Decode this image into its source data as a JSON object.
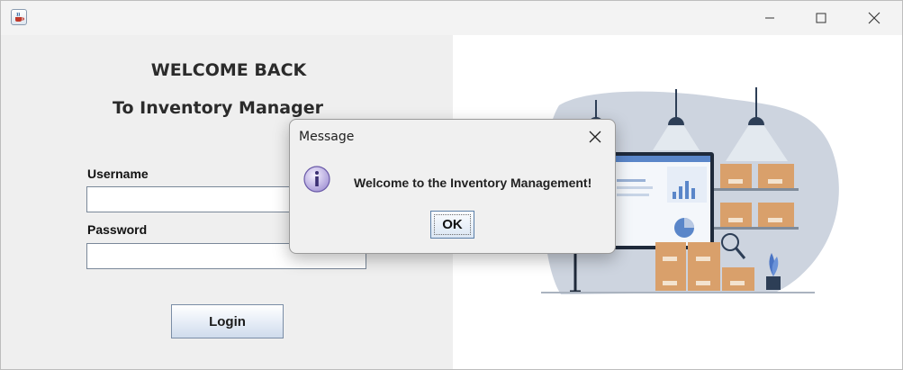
{
  "window": {
    "icon": "java-cup-icon",
    "controls": [
      "minimize-icon",
      "maximize-icon",
      "close-icon"
    ]
  },
  "login": {
    "welcome": "WELCOME BACK",
    "subtitle": "To Inventory Manager",
    "username_label": "Username",
    "username_value": "",
    "password_label": "Password",
    "password_value": "",
    "login_button": "Login"
  },
  "dialog": {
    "title": "Message",
    "icon": "info-icon",
    "message": "Welcome to the Inventory Management!",
    "ok_button": "OK"
  },
  "illustration": {
    "icon": "warehouse-inventory-illustration"
  },
  "colors": {
    "left_panel": "#efefef",
    "blob": "#cdd4df",
    "box": "#d9a06b",
    "shelf": "#808b99",
    "lamp": "#2d3e56"
  }
}
